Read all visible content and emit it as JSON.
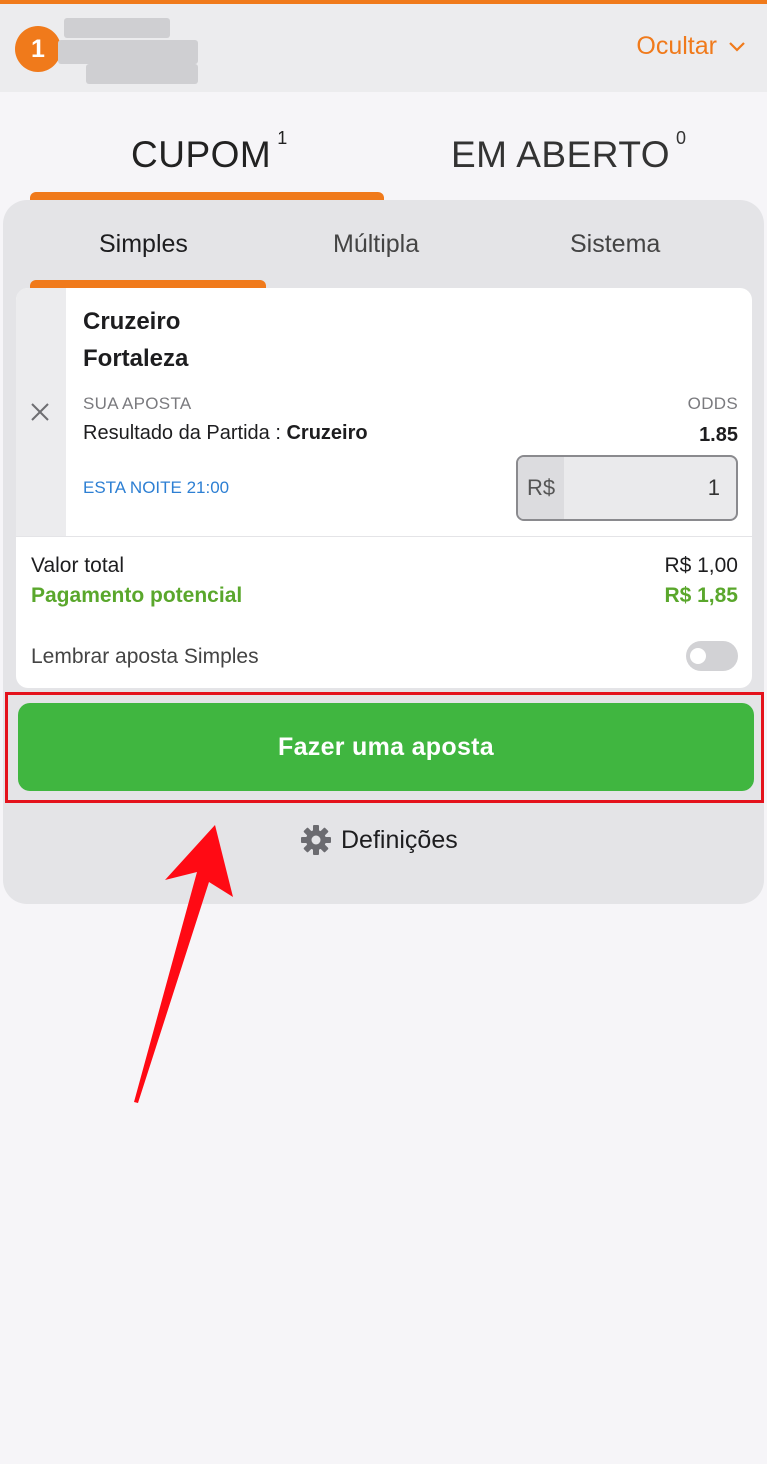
{
  "header": {
    "badge_count": "1",
    "hide_label": "Ocultar"
  },
  "tabs": [
    {
      "label": "CUPOM",
      "count": "1"
    },
    {
      "label": "EM ABERTO",
      "count": "0"
    }
  ],
  "subtabs": [
    "Simples",
    "Múltipla",
    "Sistema"
  ],
  "bet": {
    "team_home": "Cruzeiro",
    "team_away": "Fortaleza",
    "your_bet_label": "SUA APOSTA",
    "odds_label": "ODDS",
    "market_prefix": "Resultado da Partida : ",
    "selection": "Cruzeiro",
    "odds": "1.85",
    "event_time": "ESTA NOITE 21:00",
    "currency": "R$",
    "stake": "1"
  },
  "summary": {
    "total_label": "Valor total",
    "total_value": "R$ 1,00",
    "payout_label": "Pagamento potencial",
    "payout_value": "R$ 1,85",
    "remember_label": "Lembrar aposta Simples"
  },
  "actions": {
    "place_bet_label": "Fazer uma aposta",
    "settings_label": "Definições"
  },
  "colors": {
    "accent": "#f07a1b",
    "bet_button": "#40b640",
    "payout": "#5aa72c",
    "event_time": "#2d7fd3",
    "annotation": "#e4121c"
  },
  "icons": [
    "chevron-down-icon",
    "close-icon",
    "gear-icon",
    "annotation-arrow"
  ]
}
